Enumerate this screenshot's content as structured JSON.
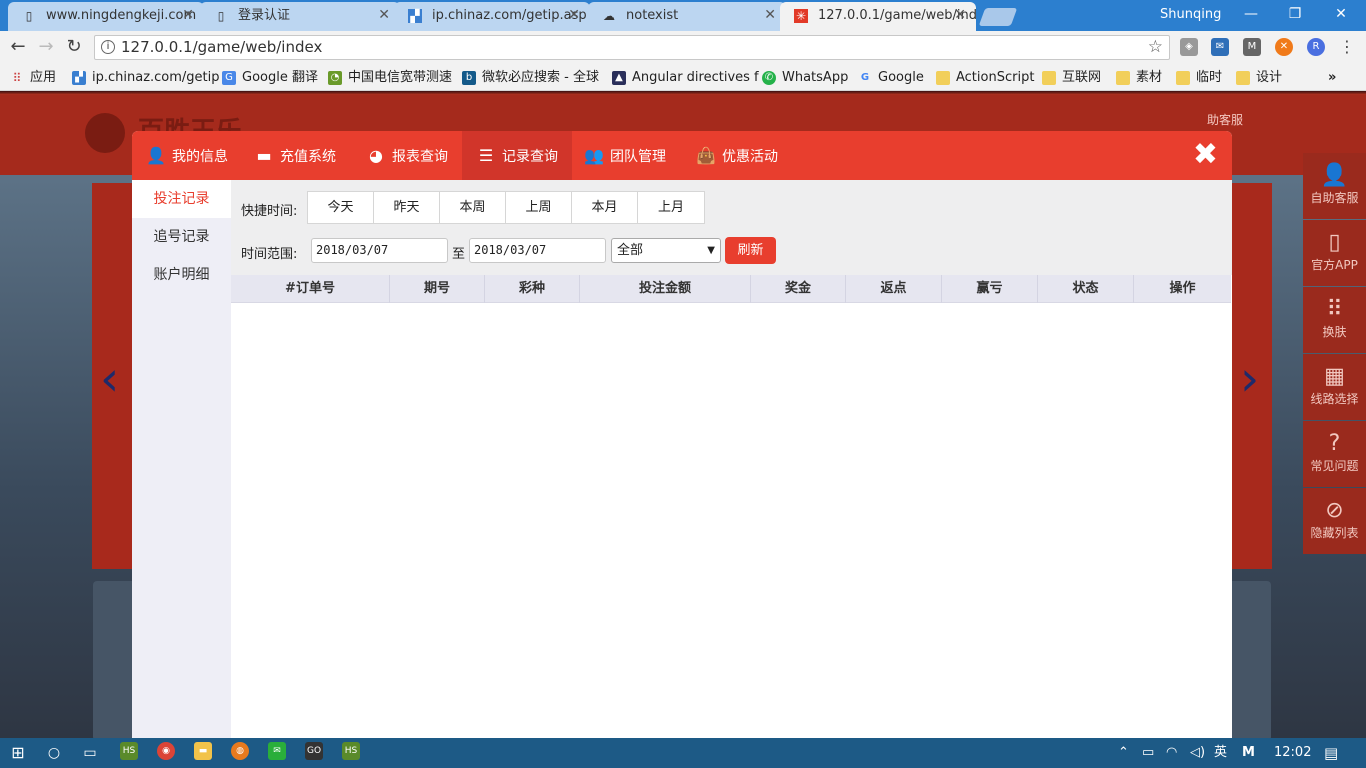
{
  "browser": {
    "tabs": [
      {
        "title": "www.ningdengkeji.com",
        "icon": "page-icon"
      },
      {
        "title": "登录认证",
        "icon": "page-icon"
      },
      {
        "title": "ip.chinaz.com/getip.asp",
        "icon": "chinaz-icon"
      },
      {
        "title": "notexist",
        "icon": "cloud-icon"
      },
      {
        "title": "127.0.0.1/game/web/index",
        "icon": "site-icon"
      }
    ],
    "profile_name": "Shunqing",
    "url": "127.0.0.1/game/web/index",
    "bookmarks": [
      {
        "label": "应用",
        "icon": "apps-icon"
      },
      {
        "label": "ip.chinaz.com/getip",
        "icon": "chinaz-icon"
      },
      {
        "label": "Google 翻译",
        "icon": "translate-icon"
      },
      {
        "label": "中国电信宽带测速",
        "icon": "speedtest-icon"
      },
      {
        "label": "微软必应搜索 - 全球",
        "icon": "bing-icon"
      },
      {
        "label": "Angular directives f",
        "icon": "angular-icon"
      },
      {
        "label": "WhatsApp",
        "icon": "whatsapp-icon"
      },
      {
        "label": "Google",
        "icon": "google-icon"
      },
      {
        "label": "ActionScript",
        "icon": "folder-icon"
      },
      {
        "label": "互联网",
        "icon": "folder-icon"
      },
      {
        "label": "素材",
        "icon": "folder-icon"
      },
      {
        "label": "临时",
        "icon": "folder-icon"
      },
      {
        "label": "设计",
        "icon": "folder-icon"
      }
    ]
  },
  "site": {
    "title": "百胜王乐",
    "help_label": "助客服",
    "side_items": [
      {
        "label": "自助客服",
        "icon": "user-icon"
      },
      {
        "label": "官方APP",
        "icon": "phone-icon"
      },
      {
        "label": "换肤",
        "icon": "dots-icon"
      },
      {
        "label": "线路选择",
        "icon": "map-icon"
      },
      {
        "label": "常见问题",
        "icon": "question-icon"
      },
      {
        "label": "隐藏列表",
        "icon": "eye-slash-icon"
      }
    ]
  },
  "modal": {
    "tabs": [
      {
        "label": "我的信息",
        "icon": "user-icon"
      },
      {
        "label": "充值系统",
        "icon": "card-icon"
      },
      {
        "label": "报表查询",
        "icon": "pie-chart-icon"
      },
      {
        "label": "记录查询",
        "icon": "list-icon"
      },
      {
        "label": "团队管理",
        "icon": "team-icon"
      },
      {
        "label": "优惠活动",
        "icon": "bag-icon"
      }
    ],
    "active_tab": "记录查询",
    "side_menu": [
      "投注记录",
      "追号记录",
      "账户明细"
    ],
    "active_side": "投注记录",
    "filter": {
      "quick_label": "快捷时间:",
      "quick_options": [
        "今天",
        "昨天",
        "本周",
        "上周",
        "本月",
        "上月"
      ],
      "range_label": "时间范围:",
      "date_from": "2018/03/07",
      "to_label": "至",
      "date_to": "2018/03/07",
      "status_selected": "全部",
      "refresh_label": "刷新"
    },
    "table_headers": [
      "#订单号",
      "期号",
      "彩种",
      "投注金额",
      "奖金",
      "返点",
      "赢亏",
      "状态",
      "操作"
    ]
  },
  "taskbar": {
    "ime": "英",
    "time": "12:02"
  },
  "colors": {
    "accent": "#e83e2e",
    "chrome_blue": "#2c7fcf"
  }
}
